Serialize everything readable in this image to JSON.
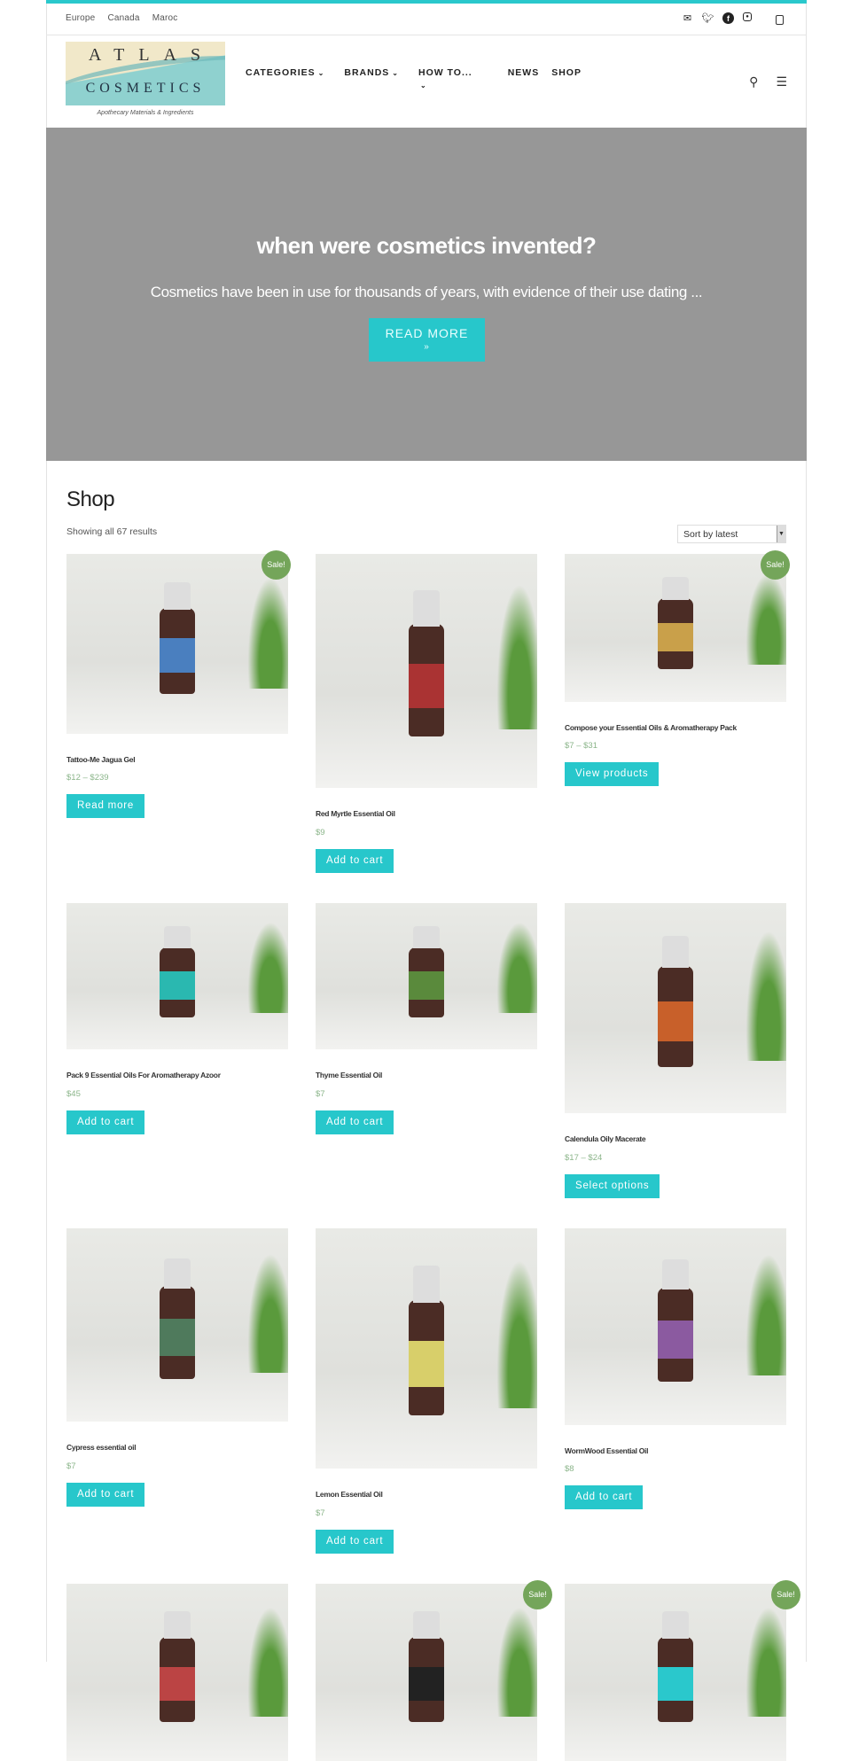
{
  "topbar": {
    "links": [
      "Europe",
      "Canada",
      "Maroc"
    ],
    "social_icons": [
      "mail-icon",
      "twitter-icon",
      "facebook-icon",
      "instagram-icon"
    ]
  },
  "header": {
    "logo_line1": "ATLAS",
    "logo_line2": "COSMETICS",
    "tagline": "Apothecary Materials & Ingredients",
    "nav": [
      {
        "label": "CATEGORIES",
        "dropdown": true
      },
      {
        "label": "BRANDS",
        "dropdown": true
      },
      {
        "label": "HOW TO...",
        "dropdown": true
      },
      {
        "label": "NEWS",
        "dropdown": false
      },
      {
        "label": "SHOP",
        "dropdown": false
      }
    ]
  },
  "hero": {
    "title": "when were cosmetics invented?",
    "excerpt": "Cosmetics have been in use for thousands of years, with evidence of their use dating ...",
    "button": "READ MORE",
    "button_arrow": "»"
  },
  "shop": {
    "title": "Shop",
    "result_count": "Showing all 67 results",
    "sort_selected": "Sort by latest"
  },
  "colors": {
    "accent": "#27c7cb",
    "sale_badge": "#74a55a",
    "price": "#8bb58a",
    "hero_bg": "#979797"
  },
  "products": [
    {
      "name": "Tattoo-Me Jagua Gel",
      "price": "$12 – $239",
      "button": "Read more",
      "sale": "Sale!"
    },
    {
      "name": "Red Myrtle Essential Oil",
      "price": "$9",
      "button": "Add to cart"
    },
    {
      "name": "Compose your Essential Oils & Aromatherapy Pack",
      "price": "$7 – $31",
      "button": "View products",
      "sale": "Sale!"
    },
    {
      "name": "Pack 9 Essential Oils For Aromatherapy Azoor",
      "price": "$45",
      "button": "Add to cart"
    },
    {
      "name": "Thyme Essential Oil",
      "price": "$7",
      "button": "Add to cart"
    },
    {
      "name": "Calendula Oily Macerate",
      "price": "$17 – $24",
      "button": "Select options"
    },
    {
      "name": "Cypress essential oil",
      "price": "$7",
      "button": "Add to cart"
    },
    {
      "name": "Lemon Essential Oil",
      "price": "$7",
      "button": "Add to cart"
    },
    {
      "name": "WormWood Essential Oil",
      "price": "$8",
      "button": "Add to cart"
    },
    {
      "sale": ""
    },
    {
      "sale": "Sale!"
    },
    {
      "sale": "Sale!"
    }
  ]
}
